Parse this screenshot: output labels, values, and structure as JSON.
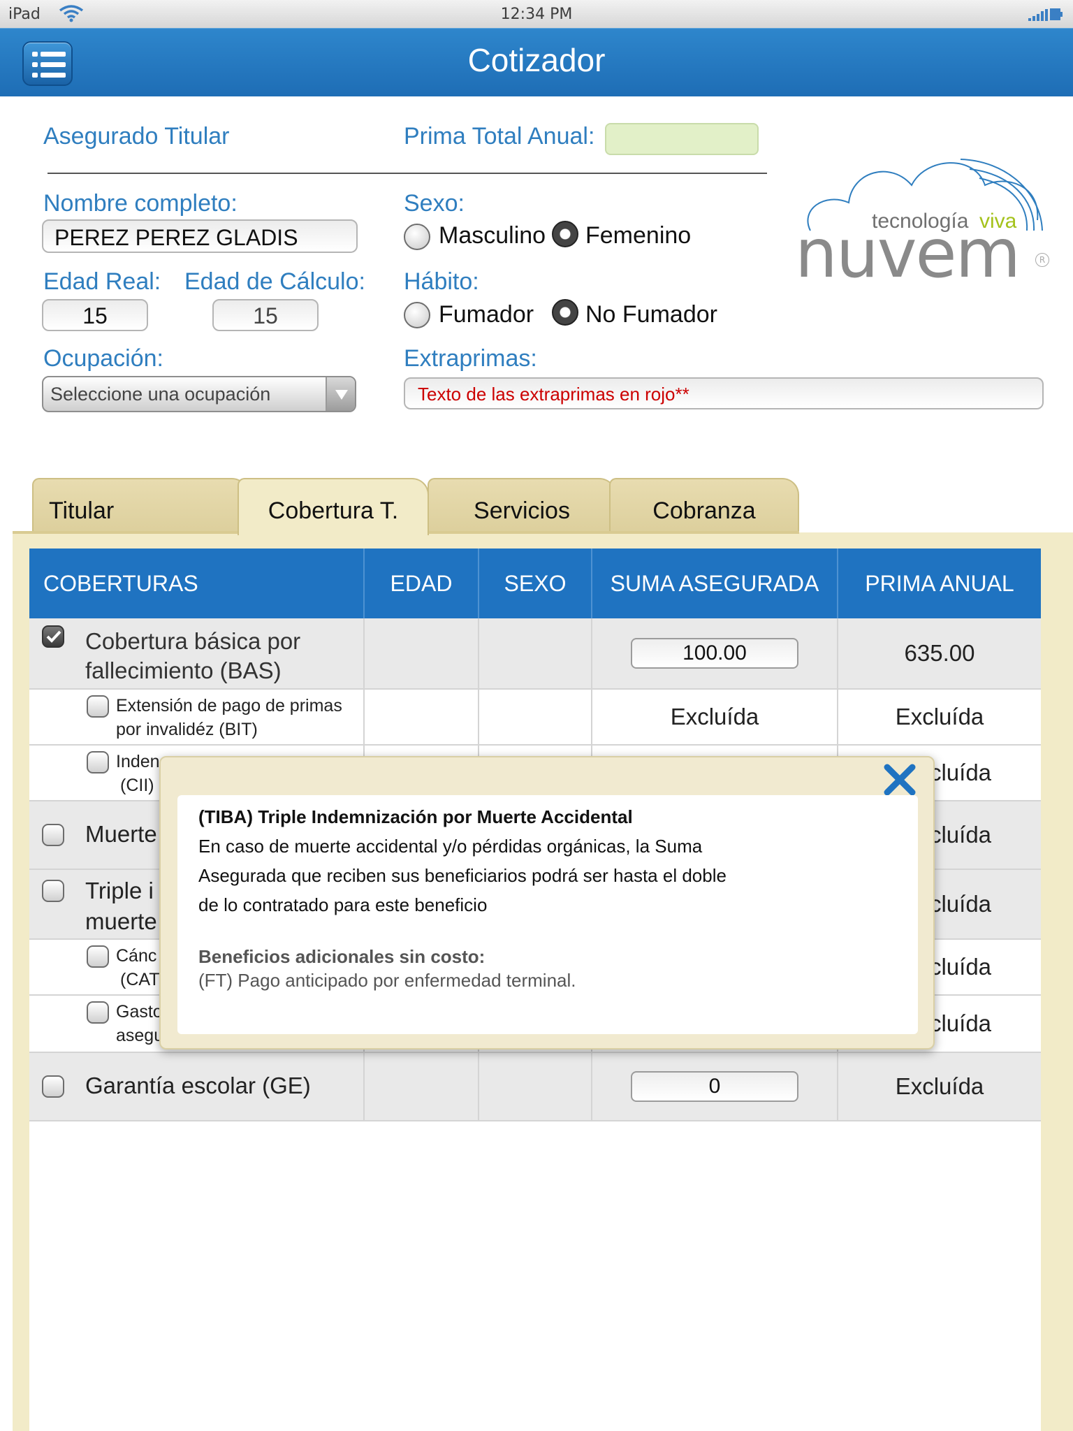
{
  "status_bar": {
    "device": "iPad",
    "time": "12:34 PM"
  },
  "nav": {
    "title": "Cotizador"
  },
  "form": {
    "asegurado_titular": "Asegurado Titular",
    "prima_total_label": "Prima Total Anual:",
    "prima_total_value": "",
    "nombre_label": "Nombre completo:",
    "nombre_value": "PEREZ PEREZ GLADIS",
    "edad_real_label": "Edad Real:",
    "edad_real_value": "15",
    "edad_calculo_label": "Edad de Cálculo:",
    "edad_calculo_value": "15",
    "ocupacion_label": "Ocupación:",
    "ocupacion_placeholder": "Seleccione una ocupación",
    "sexo_label": "Sexo:",
    "sexo_options": [
      "Masculino",
      "Femenino"
    ],
    "sexo_selected": "Femenino",
    "habito_label": "Hábito:",
    "habito_options": [
      "Fumador",
      "No Fumador"
    ],
    "habito_selected": "No Fumador",
    "extraprimas_label": "Extraprimas:",
    "extraprimas_value": "Texto de las extraprimas en rojo**"
  },
  "logo": {
    "tagline_1": "tecnología",
    "tagline_2": "viva",
    "brand": "nuvem",
    "registered": "R"
  },
  "tabs": [
    "Titular",
    "Cobertura T.",
    "Servicios",
    "Cobranza"
  ],
  "active_tab": "Cobertura T.",
  "table": {
    "headers": [
      "COBERTURAS",
      "EDAD",
      "SEXO",
      "SUMA ASEGURADA",
      "PRIMA ANUAL"
    ],
    "rows": [
      {
        "label_1": "Cobertura básica por",
        "label_2": "fallecimiento (BAS)",
        "checked": true,
        "suma": "100.00",
        "prima": "635.00"
      },
      {
        "label_1": "Extensión de pago de primas",
        "label_2": "por invalidéz (BIT)",
        "checked": false,
        "suma": "Excluída",
        "prima": "Excluída"
      },
      {
        "label_1": "Inden",
        "label_2": "(CII)",
        "checked": false,
        "prima": "cluída"
      },
      {
        "label_1": "Muerte",
        "checked": false,
        "prima": "cluída"
      },
      {
        "label_1": "Triple i",
        "label_2": "muerte",
        "checked": false,
        "prima": "cluída"
      },
      {
        "label_1": "Cánc",
        "label_2": "(CAT",
        "checked": false,
        "prima": "cluída"
      },
      {
        "label_1": "Gasto",
        "label_2": "asegu",
        "checked": false,
        "prima": "cluída"
      },
      {
        "label_1": "Garantía escolar (GE)",
        "checked": false,
        "suma": "0",
        "prima": "Excluída"
      }
    ]
  },
  "popup": {
    "title": "(TIBA) Triple Indemnización por Muerte Accidental",
    "body": [
      "En caso de muerte accidental y/o pérdidas orgánicas, la Suma",
      "Asegurada que reciben sus beneficiarios podrá ser hasta el doble",
      "de lo contratado para este beneficio"
    ],
    "subtitle": "Beneficios adicionales sin costo:",
    "subtext": "(FT) Pago anticipado por enfermedad terminal."
  },
  "colors": {
    "nav_blue": "#1f73c1",
    "label_blue": "#2f7ebf",
    "tab_beige": "#f2ebc8",
    "extraprimas_red": "#cc0000",
    "logo_green": "#a4c21b"
  }
}
